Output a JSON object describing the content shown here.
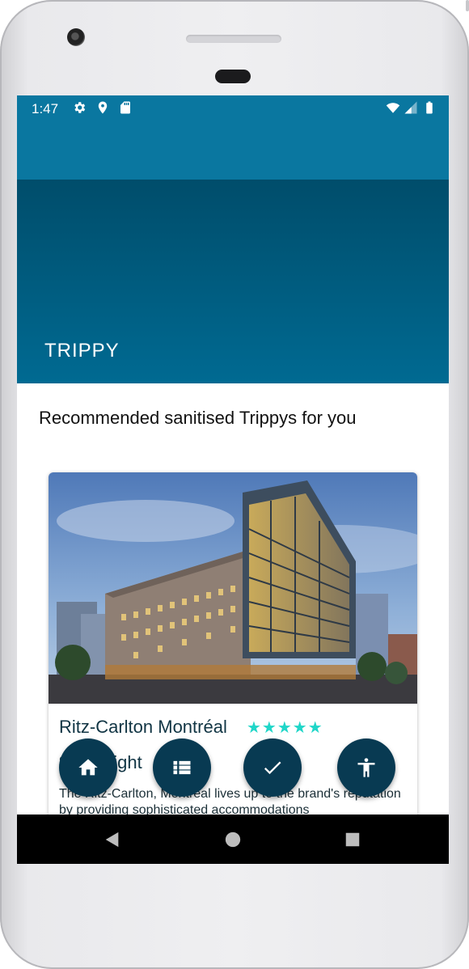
{
  "status_bar": {
    "time": "1:47"
  },
  "app": {
    "title": "TRIPPY"
  },
  "section": {
    "title": "Recommended sanitised Trippys for you"
  },
  "hotel": {
    "name": "Ritz-Carlton Montréal",
    "rating_stars": 5,
    "stars_text": "★★★★★",
    "price": "$444/night",
    "description": "The Ritz-Carlton, Montréal lives up to the brand's reputation by providing sophisticated accommodations"
  },
  "fabs": [
    {
      "icon": "home-icon"
    },
    {
      "icon": "list-icon"
    },
    {
      "icon": "check-icon"
    },
    {
      "icon": "accessibility-icon"
    }
  ],
  "colors": {
    "primary": "#0a77a0",
    "hero_dark": "#004d6b",
    "fab": "#083a52",
    "star": "#20d6c8"
  }
}
